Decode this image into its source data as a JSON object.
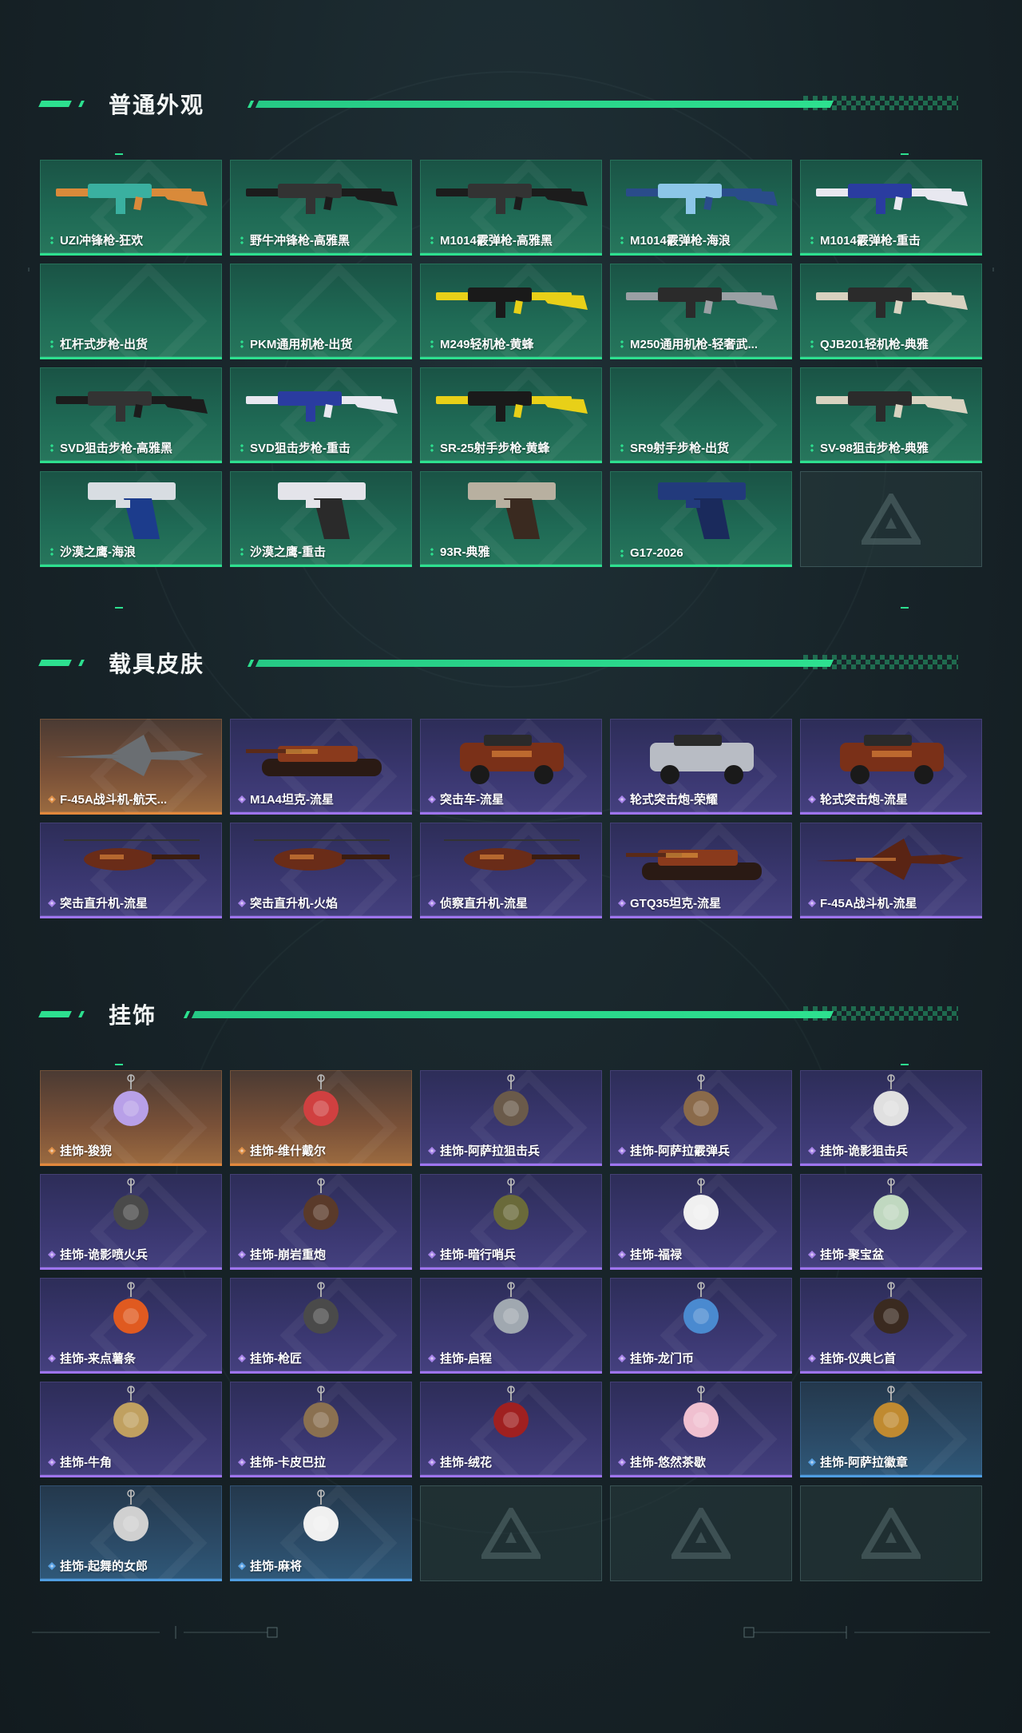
{
  "sections": {
    "weapons": {
      "title": "普通外观",
      "items": [
        {
          "label": "UZI冲锋枪-狂欢",
          "rarity": "green",
          "art": "smg-colorful"
        },
        {
          "label": "野牛冲锋枪-高雅黑",
          "rarity": "green",
          "art": "smg-black"
        },
        {
          "label": "M1014霰弹枪-高雅黑",
          "rarity": "green",
          "art": "shotgun-black"
        },
        {
          "label": "M1014霰弹枪-海浪",
          "rarity": "green",
          "art": "shotgun-wave"
        },
        {
          "label": "M1014霰弹枪-重击",
          "rarity": "green",
          "art": "shotgun-strike"
        },
        {
          "label": "杠杆式步枪-出货",
          "rarity": "green",
          "art": "none"
        },
        {
          "label": "PKM通用机枪-出货",
          "rarity": "green",
          "art": "none"
        },
        {
          "label": "M249轻机枪-黄蜂",
          "rarity": "green",
          "art": "lmg-hornet"
        },
        {
          "label": "M250通用机枪-轻奢武...",
          "rarity": "green",
          "art": "lmg-silver"
        },
        {
          "label": "QJB201轻机枪-典雅",
          "rarity": "green",
          "art": "lmg-elegant"
        },
        {
          "label": "SVD狙击步枪-高雅黑",
          "rarity": "green",
          "art": "sniper-black"
        },
        {
          "label": "SVD狙击步枪-重击",
          "rarity": "green",
          "art": "sniper-strike"
        },
        {
          "label": "SR-25射手步枪-黄蜂",
          "rarity": "green",
          "art": "rifle-hornet"
        },
        {
          "label": "SR9射手步枪-出货",
          "rarity": "green",
          "art": "none"
        },
        {
          "label": "SV-98狙击步枪-典雅",
          "rarity": "green",
          "art": "sniper-elegant"
        },
        {
          "label": "沙漠之鹰-海浪",
          "rarity": "green",
          "art": "pistol-wave"
        },
        {
          "label": "沙漠之鹰-重击",
          "rarity": "green",
          "art": "pistol-strike"
        },
        {
          "label": "93R-典雅",
          "rarity": "green",
          "art": "pistol-elegant"
        },
        {
          "label": "G17-2026",
          "rarity": "green",
          "art": "pistol-blue"
        },
        {
          "label": "",
          "rarity": "empty",
          "art": "empty"
        }
      ]
    },
    "vehicles": {
      "title": "载具皮肤",
      "items": [
        {
          "label": "F-45A战斗机-航天...",
          "rarity": "orange",
          "art": "jet-gray"
        },
        {
          "label": "M1A4坦克-流星",
          "rarity": "purple",
          "art": "tank-meteor"
        },
        {
          "label": "突击车-流星",
          "rarity": "purple",
          "art": "car-meteor"
        },
        {
          "label": "轮式突击炮-荣耀",
          "rarity": "purple",
          "art": "car-glory"
        },
        {
          "label": "轮式突击炮-流星",
          "rarity": "purple",
          "art": "car-meteor"
        },
        {
          "label": "突击直升机-流星",
          "rarity": "purple",
          "art": "heli-meteor"
        },
        {
          "label": "突击直升机-火焰",
          "rarity": "purple",
          "art": "heli-flame"
        },
        {
          "label": "侦察直升机-流星",
          "rarity": "purple",
          "art": "heli-small"
        },
        {
          "label": "GTQ35坦克-流星",
          "rarity": "purple",
          "art": "tank-meteor"
        },
        {
          "label": "F-45A战斗机-流星",
          "rarity": "purple",
          "art": "jet-meteor"
        }
      ]
    },
    "charms": {
      "title": "挂饰",
      "items": [
        {
          "label": "挂饰-狻猊",
          "rarity": "orange",
          "art": "charm"
        },
        {
          "label": "挂饰-维什戴尔",
          "rarity": "orange",
          "art": "charm"
        },
        {
          "label": "挂饰-阿萨拉狙击兵",
          "rarity": "purple",
          "art": "charm"
        },
        {
          "label": "挂饰-阿萨拉霰弹兵",
          "rarity": "purple",
          "art": "charm"
        },
        {
          "label": "挂饰-诡影狙击兵",
          "rarity": "purple",
          "art": "charm"
        },
        {
          "label": "挂饰-诡影喷火兵",
          "rarity": "purple",
          "art": "charm"
        },
        {
          "label": "挂饰-崩岩重炮",
          "rarity": "purple",
          "art": "charm"
        },
        {
          "label": "挂饰-暗行哨兵",
          "rarity": "purple",
          "art": "charm"
        },
        {
          "label": "挂饰-福禄",
          "rarity": "purple",
          "art": "charm"
        },
        {
          "label": "挂饰-聚宝盆",
          "rarity": "purple",
          "art": "charm"
        },
        {
          "label": "挂饰-来点薯条",
          "rarity": "purple",
          "art": "charm"
        },
        {
          "label": "挂饰-枪匠",
          "rarity": "purple",
          "art": "charm"
        },
        {
          "label": "挂饰-启程",
          "rarity": "purple",
          "art": "charm"
        },
        {
          "label": "挂饰-龙门币",
          "rarity": "purple",
          "art": "charm"
        },
        {
          "label": "挂饰-仪典匕首",
          "rarity": "purple",
          "art": "charm"
        },
        {
          "label": "挂饰-牛角",
          "rarity": "purple",
          "art": "charm"
        },
        {
          "label": "挂饰-卡皮巴拉",
          "rarity": "purple",
          "art": "charm"
        },
        {
          "label": "挂饰-绒花",
          "rarity": "purple",
          "art": "charm"
        },
        {
          "label": "挂饰-悠然茶歇",
          "rarity": "purple",
          "art": "charm"
        },
        {
          "label": "挂饰-阿萨拉徽章",
          "rarity": "blue",
          "art": "charm"
        },
        {
          "label": "挂饰-起舞的女郎",
          "rarity": "blue",
          "art": "charm"
        },
        {
          "label": "挂饰-麻将",
          "rarity": "blue",
          "art": "charm"
        },
        {
          "label": "",
          "rarity": "empty",
          "art": "empty"
        },
        {
          "label": "",
          "rarity": "empty",
          "art": "empty"
        },
        {
          "label": "",
          "rarity": "empty",
          "art": "empty"
        }
      ]
    }
  },
  "colors": {
    "accent": "#2de08f",
    "green_rarity": "#2de08f",
    "purple_rarity": "#9e74ef",
    "orange_rarity": "#e2883c",
    "blue_rarity": "#4f9de0"
  },
  "icons": {
    "rarity": "diamond-icon",
    "empty": "triangle-logo-icon"
  }
}
